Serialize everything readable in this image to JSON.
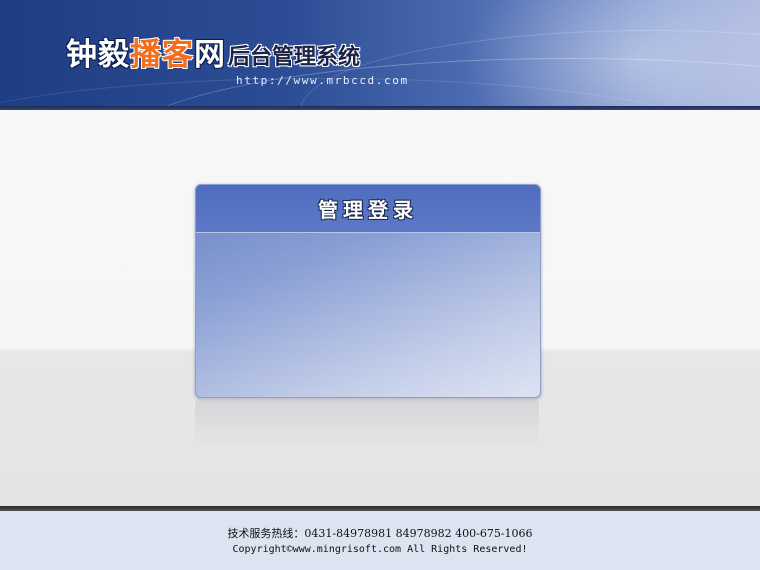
{
  "header": {
    "brand": {
      "part1": "钟毅",
      "part2": "播客",
      "part3": "网",
      "subtitle": "后台管理系统"
    },
    "url": "http://www.mrbccd.com"
  },
  "login": {
    "title": "管理登录"
  },
  "footer": {
    "hotline": "技术服务热线：0431-84978981  84978982 400-675-1066",
    "copyright": "Copyright©www.mingrisoft.com All Rights Reserved!"
  },
  "colors": {
    "banner_dark": "#1f3d83",
    "brand_orange": "#f26f1d",
    "login_header": "#5570c2",
    "footer_bg": "#dce3f1"
  }
}
